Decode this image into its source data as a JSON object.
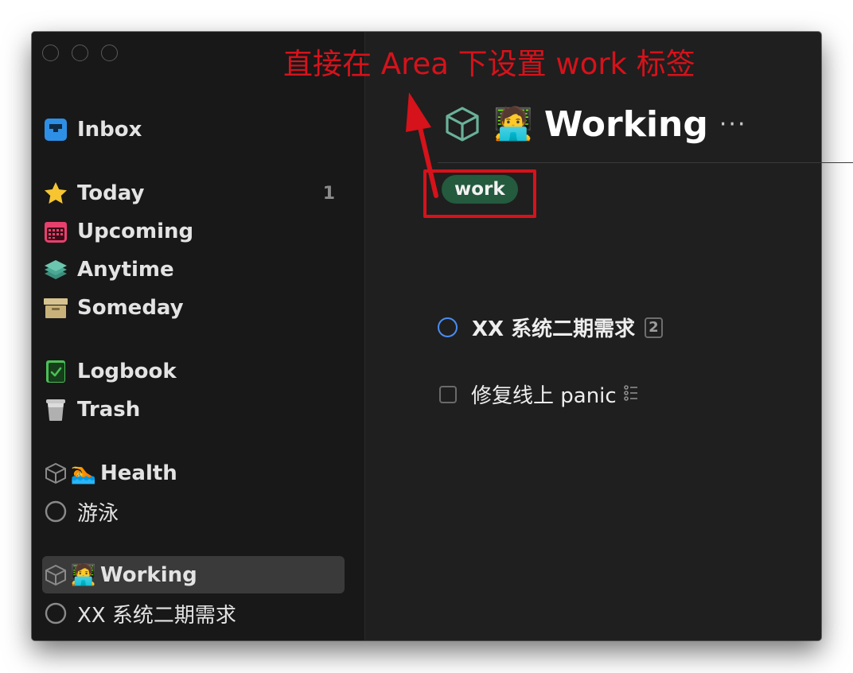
{
  "annotation": "直接在 Area 下设置 work 标签",
  "sidebar": {
    "inbox": "Inbox",
    "today": "Today",
    "today_count": "1",
    "upcoming": "Upcoming",
    "anytime": "Anytime",
    "someday": "Someday",
    "logbook": "Logbook",
    "trash": "Trash",
    "areas": [
      {
        "emoji": "🏊",
        "label": "Health",
        "projects": [
          "游泳"
        ]
      },
      {
        "emoji": "🧑‍💻",
        "label": "Working",
        "projects": [
          "XX 系统二期需求"
        ]
      }
    ]
  },
  "main": {
    "emoji": "🧑‍💻",
    "title": "Working",
    "more": "···",
    "tag": "work",
    "items": [
      {
        "title": "XX 系统二期需求",
        "badge": "2"
      },
      {
        "title": "修复线上 panic"
      }
    ]
  },
  "colors": {
    "accent_blue": "#4a8cf0",
    "tag_green": "#245a3e",
    "annotation_red": "#d6121b",
    "area_teal": "#6ab19a"
  }
}
